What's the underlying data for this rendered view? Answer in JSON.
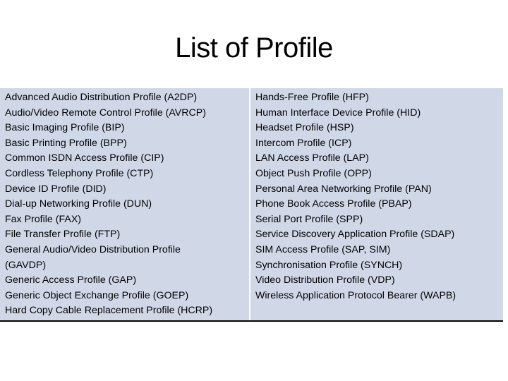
{
  "title": "List of Profile",
  "table": {
    "left_column": [
      "Advanced Audio Distribution Profile (A2DP)",
      "Audio/Video Remote Control Profile (AVRCP)",
      "Basic Imaging Profile (BIP)",
      "Basic Printing Profile (BPP)",
      "Common ISDN Access Profile (CIP)",
      "Cordless Telephony Profile (CTP)",
      "Device ID Profile (DID)",
      "Dial-up Networking Profile (DUN)",
      "Fax Profile (FAX)",
      "File Transfer Profile (FTP)",
      "General Audio/Video Distribution Profile",
      "(GAVDP)",
      "Generic Access Profile (GAP)",
      "Generic Object Exchange Profile (GOEP)",
      "Hard Copy Cable Replacement Profile (HCRP)"
    ],
    "right_column": [
      "Hands-Free Profile (HFP)",
      "Human Interface Device Profile (HID)",
      "Headset Profile (HSP)",
      "Intercom Profile (ICP)",
      "LAN Access Profile (LAP)",
      "Object Push Profile (OPP)",
      "Personal Area Networking Profile (PAN)",
      "Phone Book Access Profile (PBAP)",
      "Serial Port Profile (SPP)",
      "Service Discovery Application Profile (SDAP)",
      "SIM Access Profile (SAP, SIM)",
      "Synchronisation Profile (SYNCH)",
      "Video Distribution Profile (VDP)",
      "Wireless Application Protocol Bearer (WAPB)"
    ]
  },
  "colors": {
    "cell_background": "#d0d8e8",
    "bottom_border": "#000000",
    "divider": "#ffffff"
  }
}
